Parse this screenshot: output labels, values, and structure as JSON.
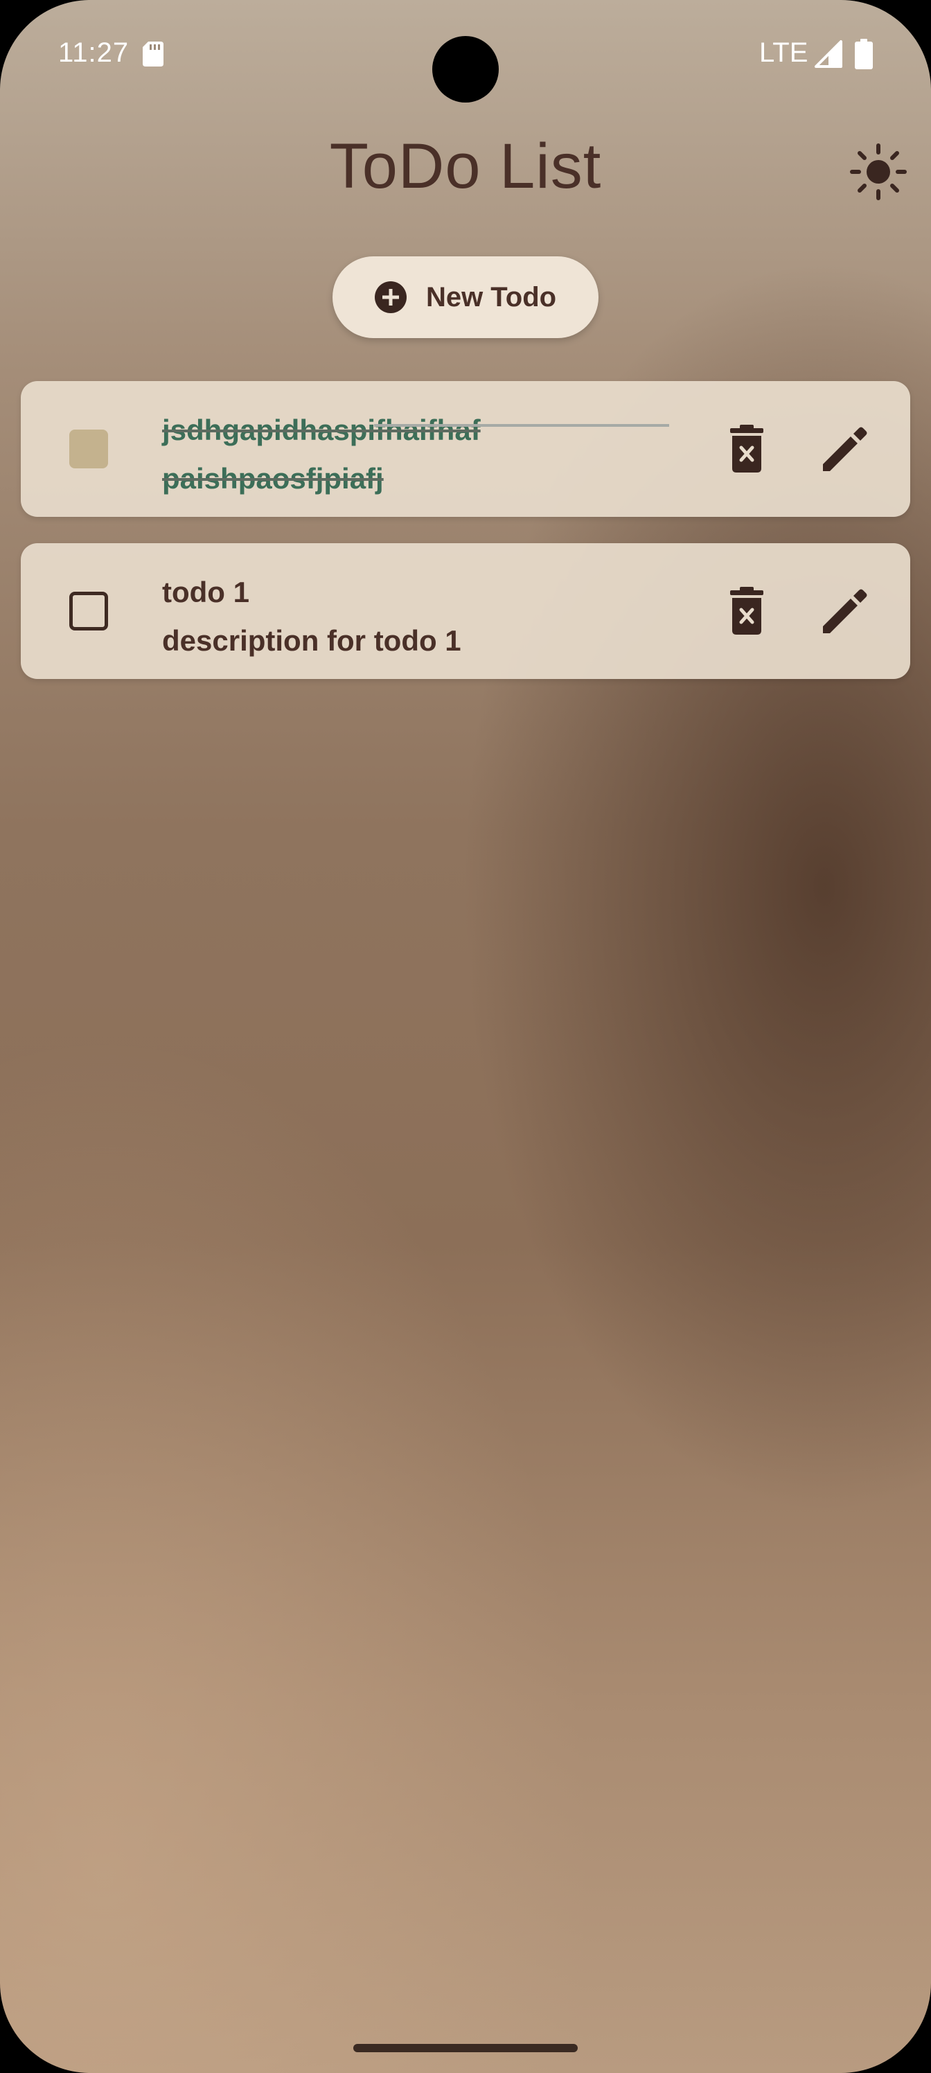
{
  "status_bar": {
    "time": "11:27",
    "network": "LTE",
    "icons": [
      "sd-card-icon",
      "signal-icon",
      "battery-icon"
    ]
  },
  "header": {
    "title": "ToDo List",
    "theme_icon": "sun-icon"
  },
  "new_todo_button": {
    "label": "New Todo",
    "icon": "add-circle-icon"
  },
  "todos": [
    {
      "title": "jsdhgapidhaspifhaifhaf",
      "description": "paishpaosfjpiafj",
      "completed": true,
      "actions": [
        "delete-icon",
        "edit-icon"
      ]
    },
    {
      "title": "todo 1",
      "description": "description for todo 1",
      "completed": false,
      "actions": [
        "delete-icon",
        "edit-icon"
      ]
    }
  ],
  "colors": {
    "title_text": "#4a3028",
    "completed_text": "#3c6e58",
    "card_background": "#e8dccc",
    "button_background": "#efe4d6",
    "checked_box": "#c4b28e"
  }
}
